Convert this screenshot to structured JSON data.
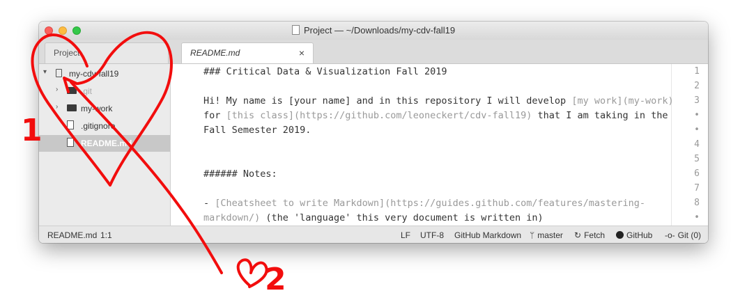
{
  "window": {
    "title": "Project — ~/Downloads/my-cdv-fall19"
  },
  "tabs": {
    "project": "Project",
    "file": "README.md",
    "close_glyph": "×"
  },
  "tree": {
    "root": "my-cdv-fall19",
    "items": [
      {
        "label": ".git",
        "type": "folder"
      },
      {
        "label": "my-work",
        "type": "folder"
      },
      {
        "label": ".gitignore",
        "type": "file"
      },
      {
        "label": "README.md",
        "type": "file",
        "selected": true
      }
    ]
  },
  "editor": {
    "lines": [
      {
        "no": "1",
        "text": "### Critical Data & Visualization Fall 2019"
      },
      {
        "no": "2",
        "text": ""
      },
      {
        "no": "3",
        "text": "Hi! My name is [your name] and in this repository I will develop ",
        "muted": "[my work](my-work)"
      },
      {
        "no": "•",
        "text": "for ",
        "muted": "[this class](https://github.com/leoneckert/cdv-fall19)",
        "after": " that I am taking in the"
      },
      {
        "no": "•",
        "text": "Fall Semester 2019."
      },
      {
        "no": "4",
        "text": ""
      },
      {
        "no": "5",
        "text": ""
      },
      {
        "no": "6",
        "text": "###### Notes:"
      },
      {
        "no": "7",
        "text": ""
      },
      {
        "no": "8",
        "text": "- ",
        "muted": "[Cheatsheet to write Markdown](https://guides.github.com/features/mastering-"
      },
      {
        "no": "•",
        "text": "",
        "muted": "markdown/)",
        "after": " (the 'language' this very document is written in)"
      }
    ]
  },
  "status": {
    "file": "README.md",
    "cursor": "1:1",
    "line_ending": "LF",
    "encoding": "UTF-8",
    "grammar": "GitHub Markdown",
    "branch": "master",
    "fetch": "Fetch",
    "github": "GitHub",
    "git": "Git (0)"
  },
  "annotations": {
    "label_1": "1",
    "label_2": "2",
    "ink_color": "#f20d0d"
  },
  "colors": {
    "close": "#fc605c",
    "minimize": "#fdbc40",
    "maximize": "#34c84a"
  }
}
